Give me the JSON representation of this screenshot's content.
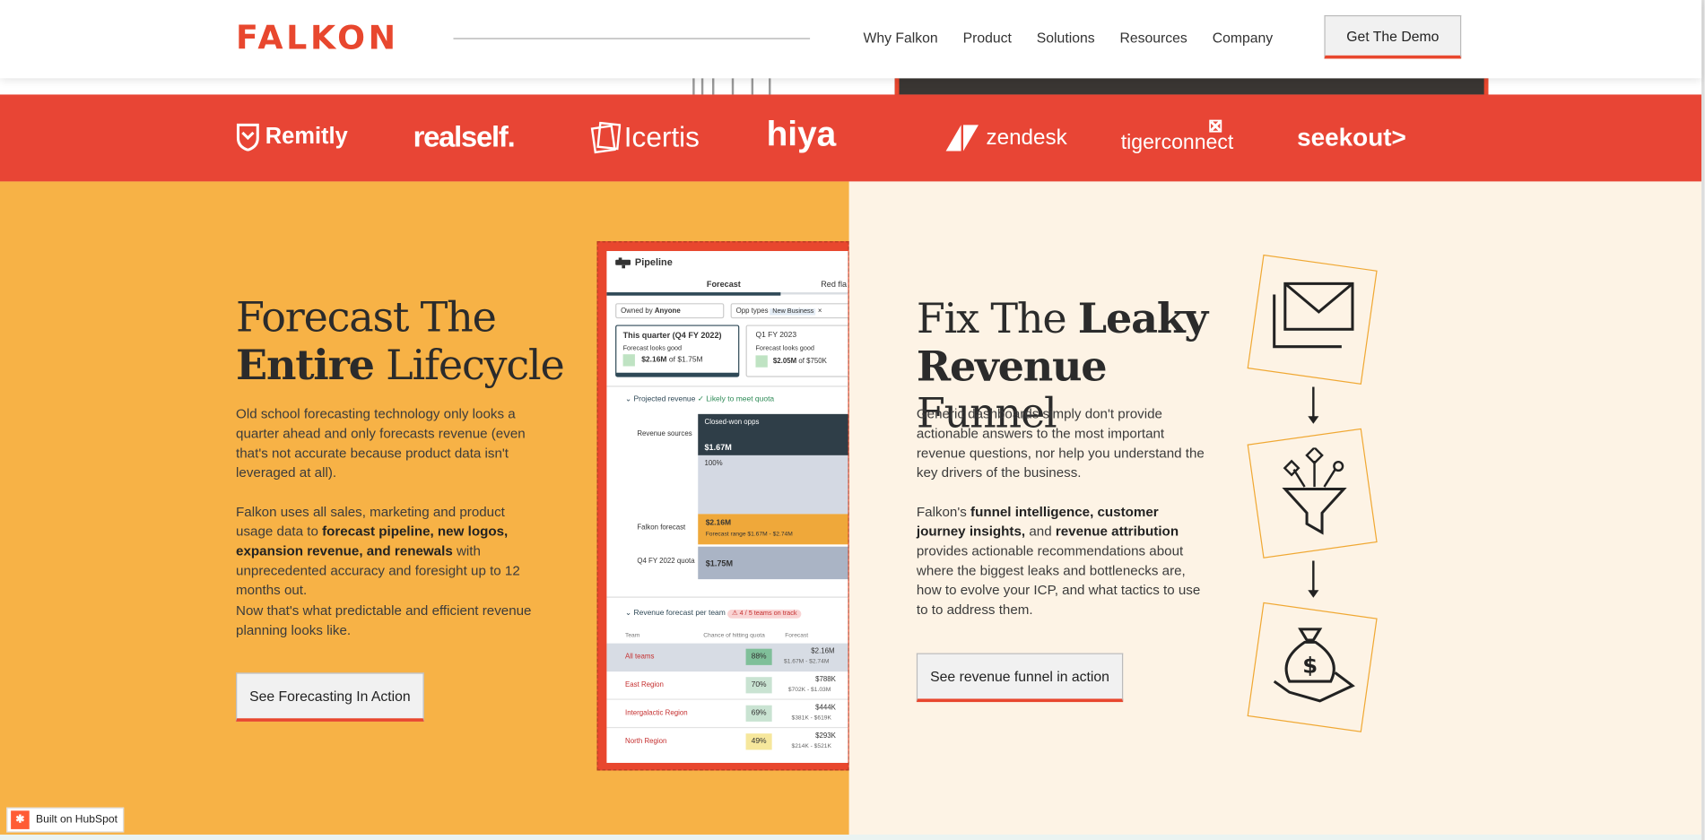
{
  "header": {
    "logo": "FALKON",
    "nav": [
      "Why Falkon",
      "Product",
      "Solutions",
      "Resources",
      "Company"
    ],
    "demo_label": "Get The Demo"
  },
  "customers": [
    "Remitly",
    "realself.",
    "Icertis",
    "hiya",
    "zendesk",
    "tigerconnect",
    "seekout>"
  ],
  "forecast": {
    "title_line1": "Forecast The",
    "title_bold": "Entire",
    "title_rest": " Lifecycle",
    "p1": "Old school forecasting technology only looks a quarter ahead and only forecasts revenue (even that's not accurate because product data isn't leveraged at all).",
    "p2_pre": "Falkon uses all sales, marketing and product usage data to ",
    "p2_bold": "forecast pipeline, new logos, expansion revenue, and renewals",
    "p2_post": " with unprecedented accuracy and foresight up to 12 months out.",
    "p3": "Now that's what predictable and efficient revenue planning looks like.",
    "cta": "See Forecasting In Action"
  },
  "dashboard": {
    "title": "Pipeline",
    "tab_forecast": "Forecast",
    "tab_red": "Red fla",
    "owned_by_label": "Owned by",
    "owned_by_value": "Anyone",
    "opp_types_label": "Opp types",
    "opp_types_value": "New Business",
    "q_this": "This quarter (Q4 FY 2022)",
    "q_this_status": "Forecast looks good",
    "q_this_value": "$2.16M",
    "q_this_of": "of $1.75M",
    "q_next": "Q1 FY 2023",
    "q_next_status": "Forecast looks good",
    "q_next_value": "$2.05M",
    "q_next_of": "of $750K",
    "proj_label": "Projected revenue",
    "proj_status": "Likely to meet quota",
    "rev_sources": "Revenue sources",
    "closed_won": "Closed-won opps",
    "closed_won_value": "$1.67M",
    "pct100": "100%",
    "falkon_forecast": "Falkon forecast",
    "falkon_value": "$2.16M",
    "falkon_range": "Forecast range $1.67M - $2.74M",
    "quota_label": "Q4 FY 2022 quota",
    "quota_value": "$1.75M",
    "per_team": "Revenue forecast per team",
    "on_track": "4 / 5 teams on track",
    "col_team": "Team",
    "col_chance": "Chance of hitting quota",
    "col_forecast": "Forecast",
    "rows": [
      {
        "team": "All teams",
        "chance": "88%",
        "fc": "$2.16M",
        "range": "$1.67M - $2.74M"
      },
      {
        "team": "East Region",
        "chance": "70%",
        "fc": "$788K",
        "range": "$702K - $1.03M"
      },
      {
        "team": "Intergalactic Region",
        "chance": "69%",
        "fc": "$444K",
        "range": "$381K - $619K"
      },
      {
        "team": "North Region",
        "chance": "49%",
        "fc": "$293K",
        "range": "$214K - $521K"
      }
    ]
  },
  "funnel": {
    "title_pre": "Fix The ",
    "title_bold1": "Leaky",
    "title_bold2": "Revenue",
    "title_rest": " Funnel",
    "p1": "Generic dashboards simply don't provide actionable answers to the most important revenue questions, nor help you understand the key drivers of the business.",
    "p2_a": "Falkon's ",
    "p2_b1": "funnel intelligence, customer journey insights,",
    "p2_c": " and ",
    "p2_b2": "revenue attribution",
    "p2_d": " provides actionable recommendations about where the biggest leaks and bottlenecks are, how to evolve your ICP, and what tactics to use to to address them.",
    "cta": "See revenue funnel in action"
  },
  "hubspot": "Built on HubSpot",
  "colors": {
    "brand": "#e8472e",
    "orange": "#f7b246",
    "cream": "#fdf3e5"
  }
}
